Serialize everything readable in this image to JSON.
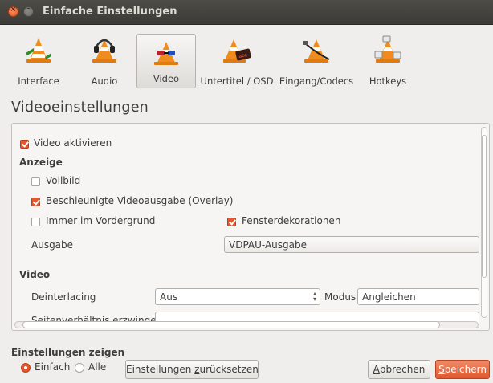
{
  "window": {
    "title": "Einfache Einstellungen"
  },
  "tabs": [
    {
      "label": "Interface",
      "icon": "cone-interface-icon"
    },
    {
      "label": "Audio",
      "icon": "cone-headphones-icon"
    },
    {
      "label": "Video",
      "icon": "cone-glasses-icon",
      "active": true
    },
    {
      "label": "Untertitel / OSD",
      "icon": "cone-subtitle-icon"
    },
    {
      "label": "Eingang/Codecs",
      "icon": "cone-cable-icon"
    },
    {
      "label": "Hotkeys",
      "icon": "cone-hotkeys-icon"
    }
  ],
  "page": {
    "heading": "Videoeinstellungen"
  },
  "settings": {
    "video_enable": {
      "label": "Video aktivieren",
      "checked": true
    },
    "display_section": "Anzeige",
    "fullscreen": {
      "label": "Vollbild",
      "checked": false
    },
    "overlay": {
      "label": "Beschleunigte Videoausgabe (Overlay)",
      "checked": true
    },
    "always_on_top": {
      "label": "Immer im Vordergrund",
      "checked": false
    },
    "window_decorations": {
      "label": "Fensterdekorationen",
      "checked": true
    },
    "output_label": "Ausgabe",
    "output_value": "VDPAU-Ausgabe",
    "video_section": "Video",
    "deinterlacing_label": "Deinterlacing",
    "deinterlacing_value": "Aus",
    "mode_label": "Modus",
    "mode_value": "Angleichen",
    "aspect_label": "Seitenverhältnis erzwingen",
    "aspect_value": ""
  },
  "footer": {
    "show_label": "Einstellungen zeigen",
    "simple_label": "Einfach",
    "all_label": "Alle",
    "selected": "Einfach",
    "reset": {
      "pre": "Einstellungen ",
      "ul": "z",
      "post": "urücksetzen"
    },
    "cancel": {
      "ul": "A",
      "post": "bbrechen"
    },
    "save": {
      "ul": "S",
      "post": "peichern"
    }
  },
  "colors": {
    "accent": "#e5572f",
    "titlebar": "#3c3b37",
    "background": "#efeeec"
  }
}
